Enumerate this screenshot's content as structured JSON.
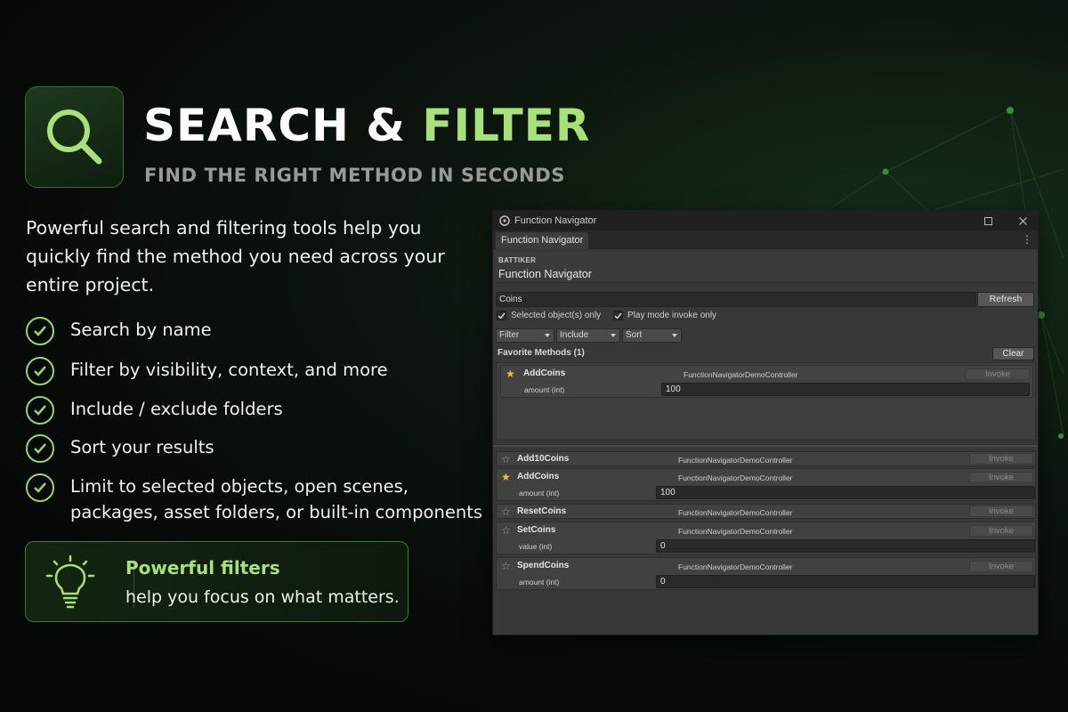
{
  "hero": {
    "icon": "magnifier-icon",
    "title_main": "SEARCH & ",
    "title_accent": "FILTER",
    "subtitle": "FIND THE RIGHT METHOD IN SECONDS",
    "intro": "Powerful search and filtering tools help you quickly find the method you need across your entire project."
  },
  "features": [
    "Search by name",
    "Filter by visibility, context, and more",
    "Include / exclude folders",
    "Sort your results",
    "Limit to selected objects, open scenes, packages, asset folders, or built-in components"
  ],
  "callout": {
    "icon": "lightbulb-icon",
    "heading": "Powerful filters",
    "text": "help you focus on what matters."
  },
  "colors": {
    "accent": "#a8e07a",
    "background": "#0c140d",
    "panel": "#383838",
    "star": "#f2c12e"
  },
  "window": {
    "title": "Function Navigator",
    "tab": "Function Navigator",
    "brand": "BATTIKER",
    "header_title": "Function Navigator",
    "search_value": "Coins",
    "refresh_label": "Refresh",
    "toggle_selected": "Selected object(s) only",
    "toggle_playmode": "Play mode invoke only",
    "filter_label": "Filter",
    "include_label": "Include",
    "sort_label": "Sort",
    "favorites_heading": "Favorite Methods (1)",
    "clear_label": "Clear",
    "favorite": {
      "name": "AddCoins",
      "class": "FunctionNavigatorDemoController",
      "invoke": "Invoke",
      "param_label": "amount (int)",
      "param_value": "100"
    },
    "methods": [
      {
        "name": "Add10Coins",
        "class": "FunctionNavigatorDemoController",
        "invoke": "Invoke",
        "favorite": false
      },
      {
        "name": "AddCoins",
        "class": "FunctionNavigatorDemoController",
        "invoke": "Invoke",
        "favorite": true,
        "param_label": "amount (int)",
        "param_value": "100"
      },
      {
        "name": "ResetCoins",
        "class": "FunctionNavigatorDemoController",
        "invoke": "Invoke",
        "favorite": false
      },
      {
        "name": "SetCoins",
        "class": "FunctionNavigatorDemoController",
        "invoke": "Invoke",
        "favorite": false,
        "param_label": "value (int)",
        "param_value": "0"
      },
      {
        "name": "SpendCoins",
        "class": "FunctionNavigatorDemoController",
        "invoke": "Invoke",
        "favorite": false,
        "param_label": "amount (int)",
        "param_value": "0"
      }
    ]
  }
}
